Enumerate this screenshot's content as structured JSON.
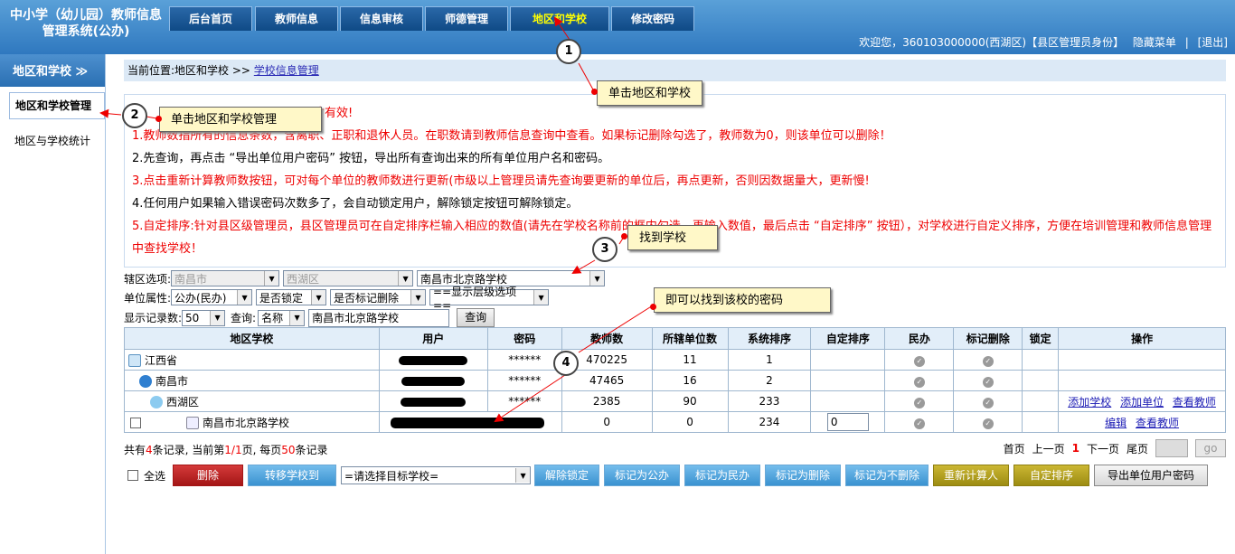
{
  "header": {
    "logo_line1": "中小学（幼儿园）教师信息",
    "logo_line2": "管理系统(公办)",
    "tabs": [
      "后台首页",
      "教师信息",
      "信息审核",
      "师德管理",
      "地区和学校",
      "修改密码"
    ],
    "active_tab": "地区和学校",
    "welcome": "欢迎您，360103000000(西湖区)【县区管理员身份】",
    "hide_menu": "隐藏菜单",
    "logout": "[退出]"
  },
  "sidebar": {
    "title": "地区和学校",
    "items": [
      "地区和学校管理",
      "地区与学校统计"
    ]
  },
  "breadcrumb": {
    "prefix": "当前位置:地区和学校 >>",
    "link": "学校信息管理"
  },
  "notes": [
    {
      "text": "才有效!",
      "red": true
    },
    {
      "text": "1.教师数指所有的信息条数，含离职、正职和退休人员。在职数请到教师信息查询中查看。如果标记删除勾选了，教师数为0，则该单位可以删除！",
      "red": true
    },
    {
      "text": "2.先查询，再点击 “导出单位用户密码” 按钮，导出所有查询出来的所有单位用户名和密码。",
      "red": false
    },
    {
      "text": "3.点击重新计算教师数按钮，可对每个单位的教师数进行更新(市级以上管理员请先查询要更新的单位后，再点更新，否则因数据量大，更新慢!",
      "red": true
    },
    {
      "text": "4.任何用户如果输入错误密码次数多了，会自动锁定用户，解除锁定按钮可解除锁定。",
      "red": false
    },
    {
      "text": "5.自定排序:针对县区级管理员，县区管理员可在自定排序栏输入相应的数值(请先在学校名称前的框内勾选，再输入数值，最后点击 “自定排序” 按钮），对学校进行自定义排序，方便在培训管理和教师信息管理中查找学校！",
      "red": true
    }
  ],
  "filters": {
    "area_label": "辖区选项:",
    "city": "南昌市",
    "district": "西湖区",
    "school": "南昌市北京路学校",
    "attr_label": "单位属性:",
    "attr": "公办(民办)",
    "locked": "是否锁定",
    "deleted": "是否标记删除",
    "levels": "==显示层级选项==",
    "count_label": "显示记录数:",
    "count": "50",
    "query_label": "查询:",
    "query_field": "名称",
    "query_value": "南昌市北京路学校",
    "query_button": "查询"
  },
  "table": {
    "headers": [
      "地区学校",
      "用户",
      "密码",
      "教师数",
      "所辖单位数",
      "系统排序",
      "自定排序",
      "民办",
      "标记删除",
      "锁定",
      "操作"
    ],
    "rows": [
      {
        "name": "江西省",
        "pwd": "******",
        "teachers": "470225",
        "units": "11",
        "sort": "1",
        "actions": []
      },
      {
        "name": "南昌市",
        "pwd": "******",
        "teachers": "47465",
        "units": "16",
        "sort": "2",
        "actions": []
      },
      {
        "name": "西湖区",
        "pwd": "******",
        "teachers": "2385",
        "units": "90",
        "sort": "233",
        "actions": [
          "添加学校",
          "添加单位",
          "查看教师"
        ]
      },
      {
        "name": "南昌市北京路学校",
        "pwd": "",
        "teachers": "0",
        "units": "0",
        "sort": "234",
        "custom": "0",
        "actions": [
          "编辑",
          "查看教师"
        ]
      }
    ]
  },
  "stats": {
    "a": "共有",
    "n": "4",
    "b": "条记录, 当前第",
    "p": "1/1",
    "c": "页, 每页",
    "per": "50",
    "d": "条记录"
  },
  "pager": {
    "first": "首页",
    "prev": "上一页",
    "cur": "1",
    "next": "下一页",
    "last": "尾页",
    "go": "go"
  },
  "actions": {
    "select_all": "全选",
    "buttons": [
      "删除",
      "转移学校到",
      "解除锁定",
      "标记为公办",
      "标记为民办",
      "标记为删除",
      "标记为不删除",
      "重新计算人数",
      "自定排序",
      "导出单位用户密码"
    ],
    "target_select": "=请选择目标学校="
  },
  "annotations": [
    {
      "num": "1",
      "text": "单击地区和学校"
    },
    {
      "num": "2",
      "text": "单击地区和学校管理"
    },
    {
      "num": "3",
      "text": "找到学校"
    },
    {
      "num": "4",
      "text": "即可以找到该校的密码"
    }
  ]
}
